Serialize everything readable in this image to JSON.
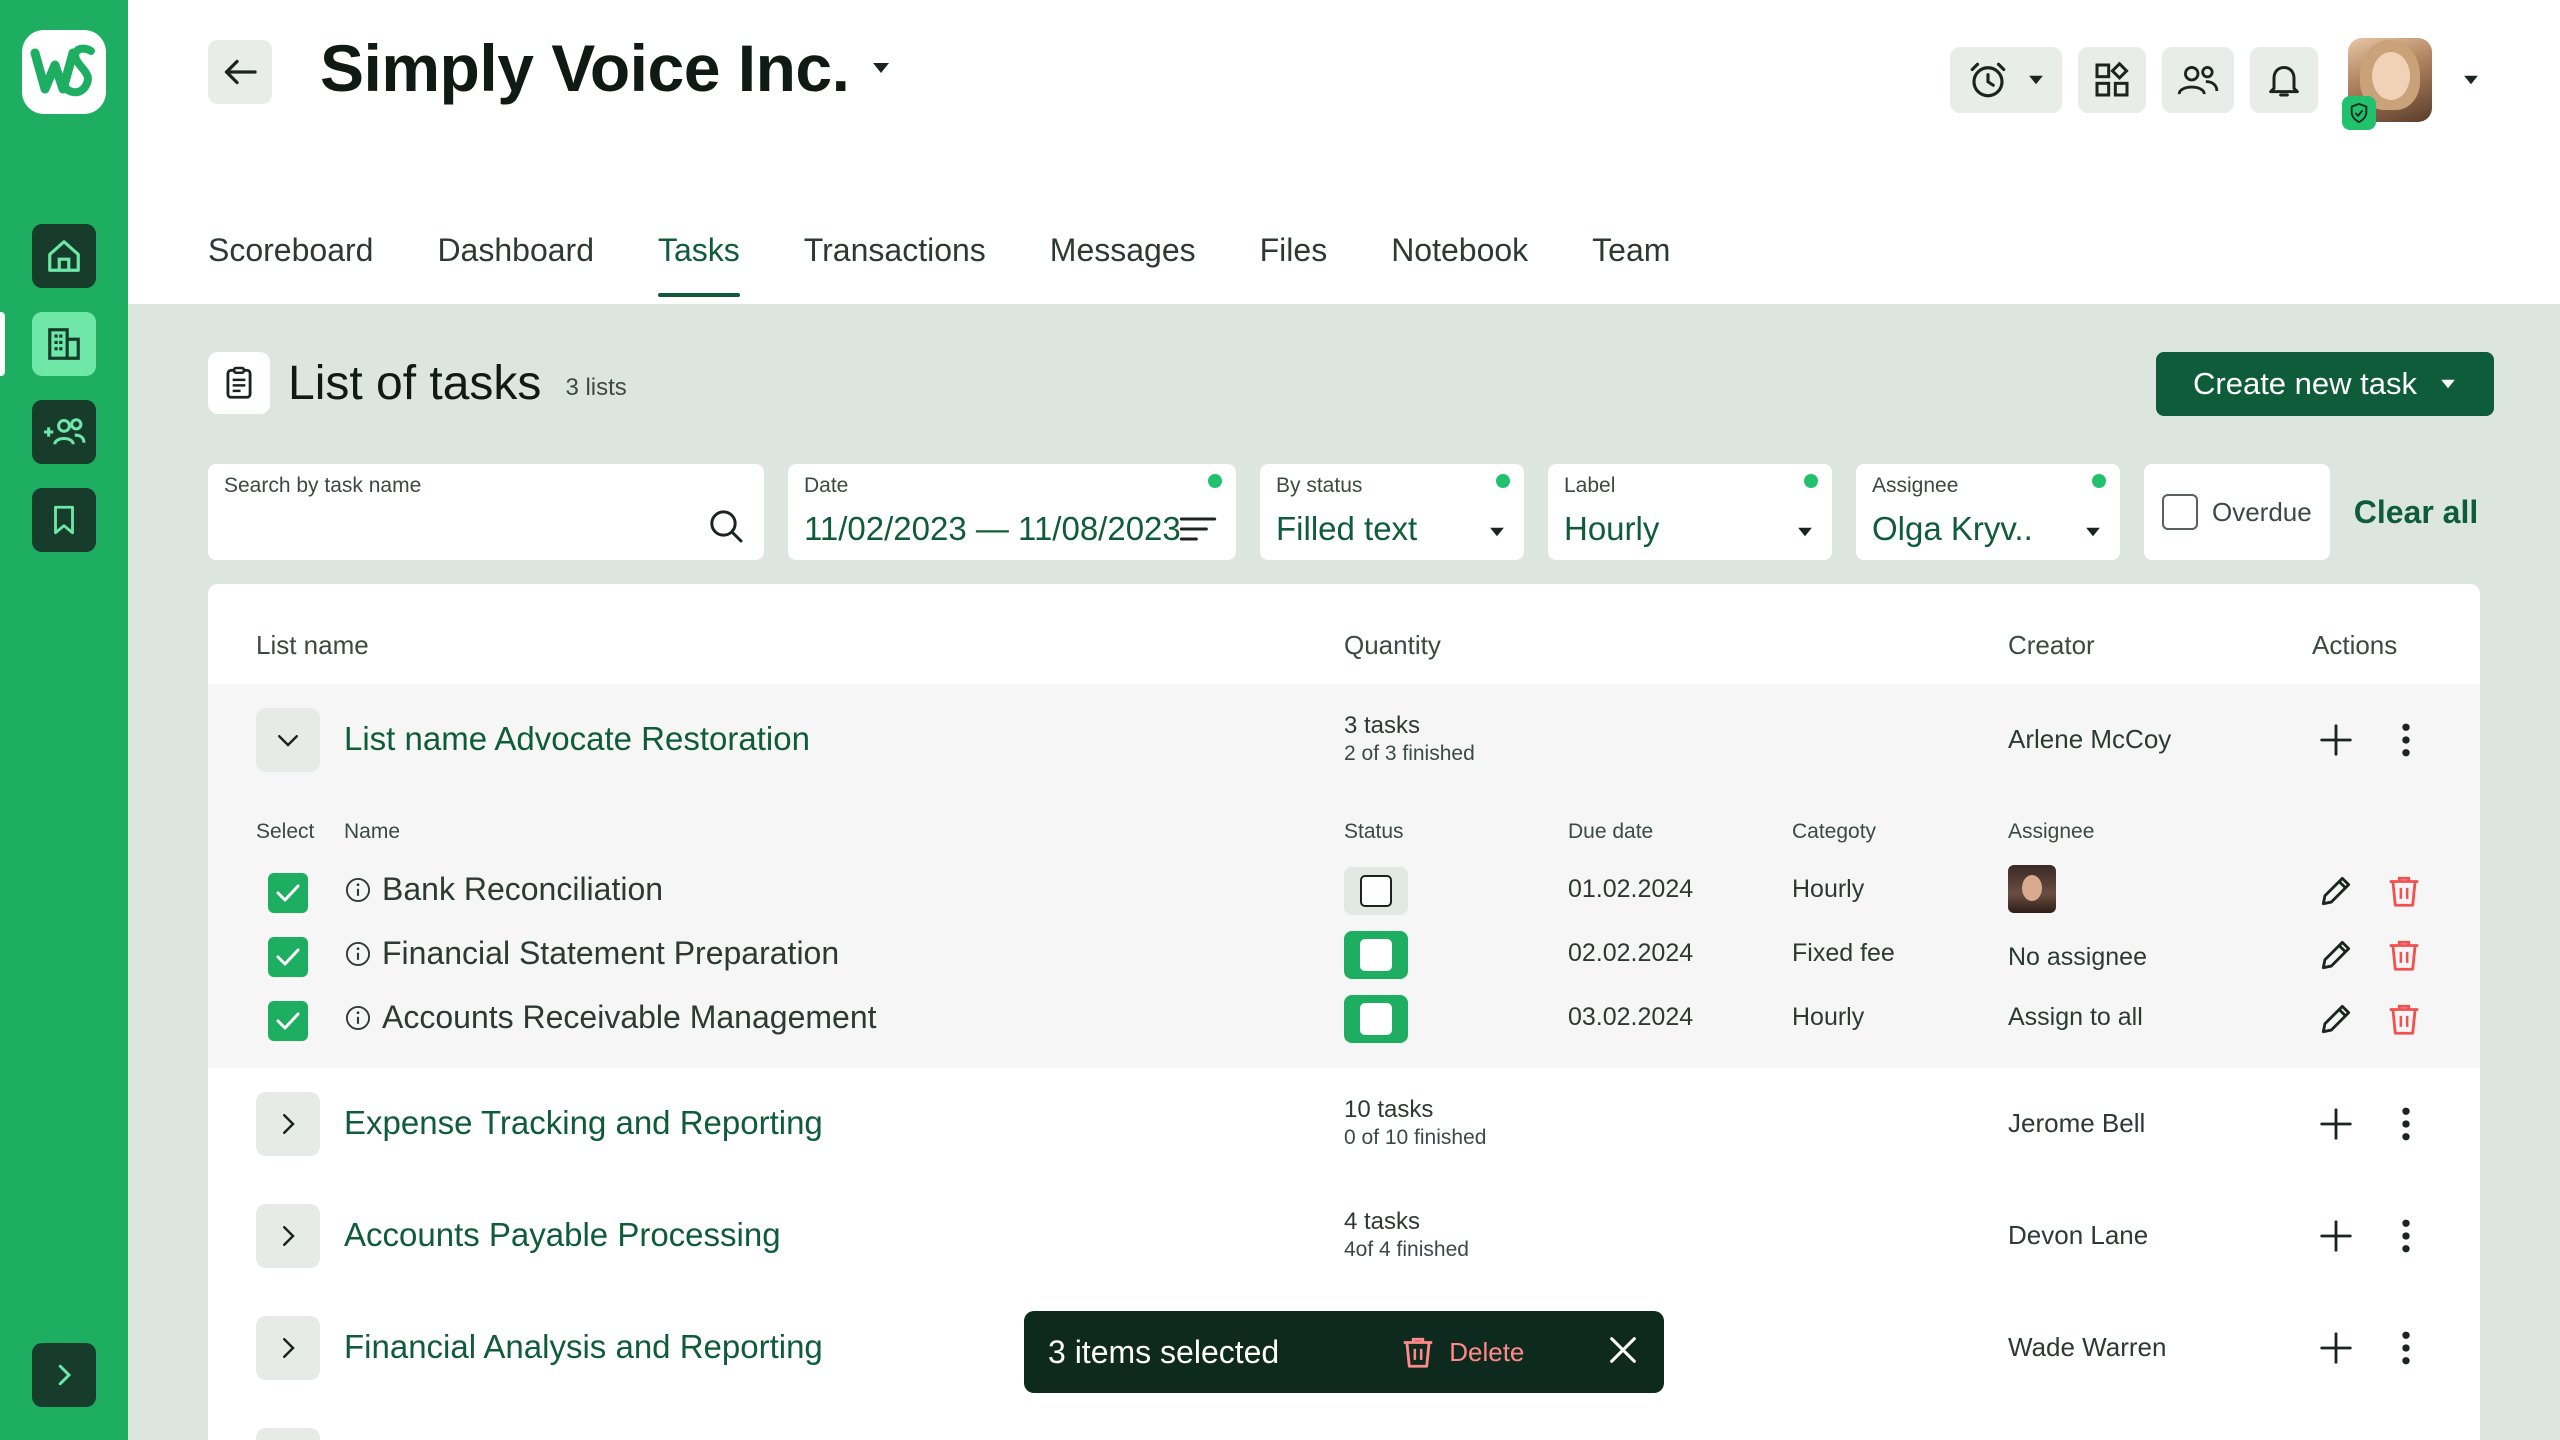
{
  "app": {
    "logo_text": "WS",
    "accent": "#1eae62",
    "dark_green": "#0f5c3a"
  },
  "sidebar": {
    "items": [
      {
        "name": "home",
        "icon": "home-icon"
      },
      {
        "name": "company",
        "icon": "building-icon"
      },
      {
        "name": "add-team",
        "icon": "add-users-icon"
      },
      {
        "name": "bookmarks",
        "icon": "bookmark-icon"
      }
    ],
    "expand_icon": "chevron-right-icon"
  },
  "header": {
    "company_name": "Simply Voice Inc.",
    "icons": [
      "alarm-clock-icon",
      "apps-grid-icon",
      "team-icon",
      "bell-icon"
    ]
  },
  "tabs": [
    {
      "label": "Scoreboard",
      "active": false
    },
    {
      "label": "Dashboard",
      "active": false
    },
    {
      "label": "Tasks",
      "active": true
    },
    {
      "label": "Transactions",
      "active": false
    },
    {
      "label": "Messages",
      "active": false
    },
    {
      "label": "Files",
      "active": false
    },
    {
      "label": "Notebook",
      "active": false
    },
    {
      "label": "Team",
      "active": false
    }
  ],
  "main": {
    "title": "List of tasks",
    "count": "3 lists",
    "create_button": "Create new task"
  },
  "filters": {
    "search_label": "Search by task name",
    "date_label": "Date",
    "date_value": "11/02/2023 — 11/08/2023",
    "status_label": "By status",
    "status_value": "Filled text",
    "label_label": "Label",
    "label_value": "Hourly",
    "assignee_label": "Assignee",
    "assignee_value": "Olga Kryv..",
    "overdue_label": "Overdue",
    "clear_all": "Clear all"
  },
  "table": {
    "headers": {
      "list_name": "List name",
      "quantity": "Quantity",
      "creator": "Creator",
      "actions": "Actions"
    },
    "sub_headers": {
      "select": "Select",
      "name": "Name",
      "status": "Status",
      "due_date": "Due date",
      "category": "Categoty",
      "assignee": "Assignee"
    },
    "groups": [
      {
        "name": "List name Advocate Restoration",
        "tasks": "3 tasks",
        "finished": "2 of 3 finished",
        "creator": "Arlene McCoy"
      },
      {
        "name": "Expense Tracking and Reporting",
        "tasks": "10 tasks",
        "finished": "0 of 10 finished",
        "creator": "Jerome Bell"
      },
      {
        "name": "Accounts Payable Processing",
        "tasks": "4 tasks",
        "finished": "4of 4 finished",
        "creator": "Devon Lane"
      },
      {
        "name": "Financial Analysis and Reporting",
        "tasks": "",
        "finished": "",
        "creator": "Wade Warren"
      }
    ],
    "tasks": [
      {
        "name": "Bank Reconciliation",
        "status_on": false,
        "due": "01.02.2024",
        "category": "Hourly",
        "assignee": ""
      },
      {
        "name": "Financial Statement Preparation",
        "status_on": true,
        "due": "02.02.2024",
        "category": "Fixed fee",
        "assignee": "No assignee"
      },
      {
        "name": "Accounts Receivable Management",
        "status_on": true,
        "due": "03.02.2024",
        "category": "Hourly",
        "assignee": "Assign to all"
      }
    ]
  },
  "toast": {
    "text": "3 items selected",
    "delete": "Delete"
  }
}
